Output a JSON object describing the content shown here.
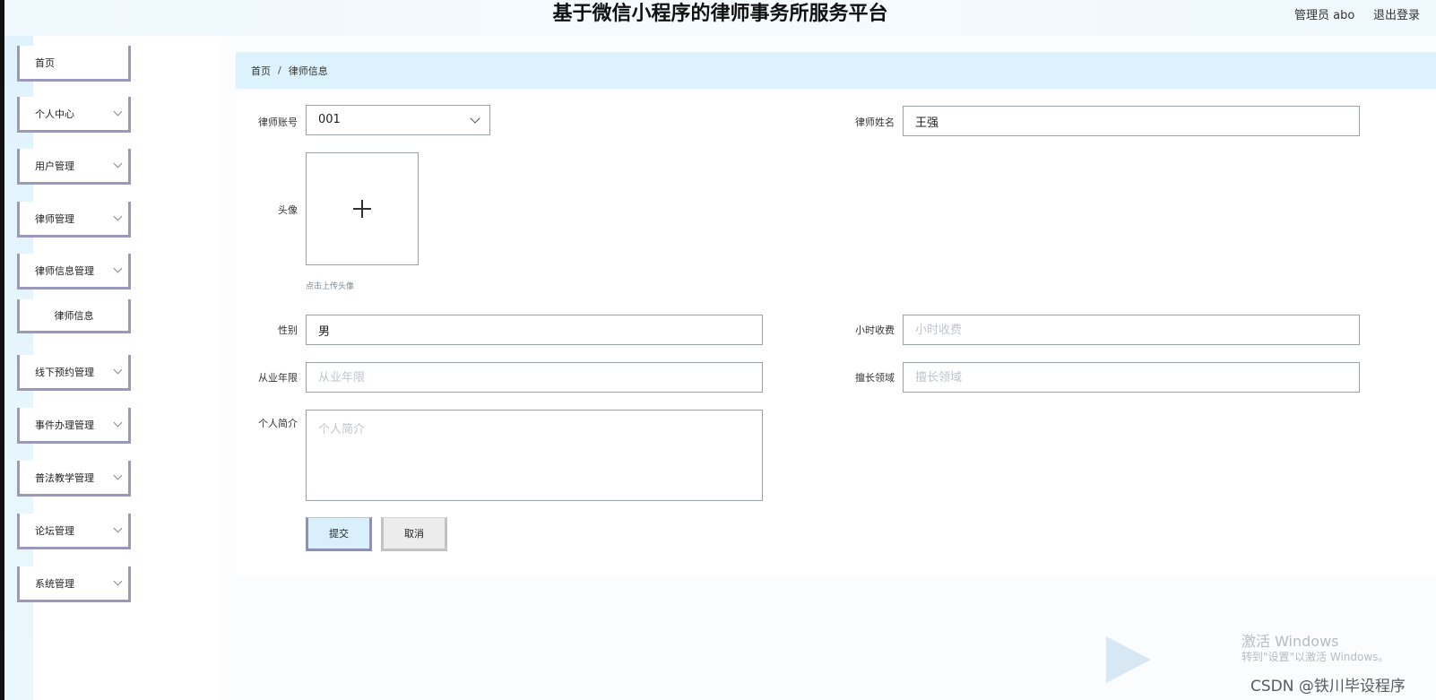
{
  "header": {
    "title": "基于微信小程序的律师事务所服务平台",
    "user": "管理员 abo",
    "logout": "退出登录"
  },
  "sidebar": {
    "items": [
      {
        "label": "首页",
        "chevron": false
      },
      {
        "label": "个人中心",
        "chevron": true
      },
      {
        "label": "用户管理",
        "chevron": true
      },
      {
        "label": "律师管理",
        "chevron": true
      },
      {
        "label": "律师信息管理",
        "chevron": true
      },
      {
        "label": "线下预约管理",
        "chevron": true
      },
      {
        "label": "事件办理管理",
        "chevron": true
      },
      {
        "label": "普法教学管理",
        "chevron": true
      },
      {
        "label": "论坛管理",
        "chevron": true
      },
      {
        "label": "系统管理",
        "chevron": true
      }
    ],
    "submenu": {
      "label": "律师信息"
    }
  },
  "breadcrumb": {
    "home": "首页",
    "separator": "/",
    "current": "律师信息"
  },
  "form": {
    "account": {
      "label": "律师账号",
      "value": "001"
    },
    "name": {
      "label": "律师姓名",
      "value": "王强"
    },
    "avatar": {
      "label": "头像",
      "hint": "点击上传头像"
    },
    "gender": {
      "label": "性别",
      "value": "男"
    },
    "hourly_fee": {
      "label": "小时收费",
      "placeholder": "小时收费"
    },
    "years": {
      "label": "从业年限",
      "placeholder": "从业年限"
    },
    "specialty": {
      "label": "擅长领域",
      "placeholder": "擅长领域"
    },
    "intro": {
      "label": "个人简介",
      "placeholder": "个人简介"
    },
    "submit_label": "提交",
    "cancel_label": "取消"
  },
  "watermark": {
    "activate": "激活 Windows",
    "activate_sub": "转到\"设置\"以激活 Windows。",
    "csdn": "CSDN @铁川毕设程序"
  },
  "colors": {
    "accent_border": "#9a98bb",
    "breadcrumb_bg": "#dcf3fd",
    "submit_bg": "#d9f0fc"
  }
}
